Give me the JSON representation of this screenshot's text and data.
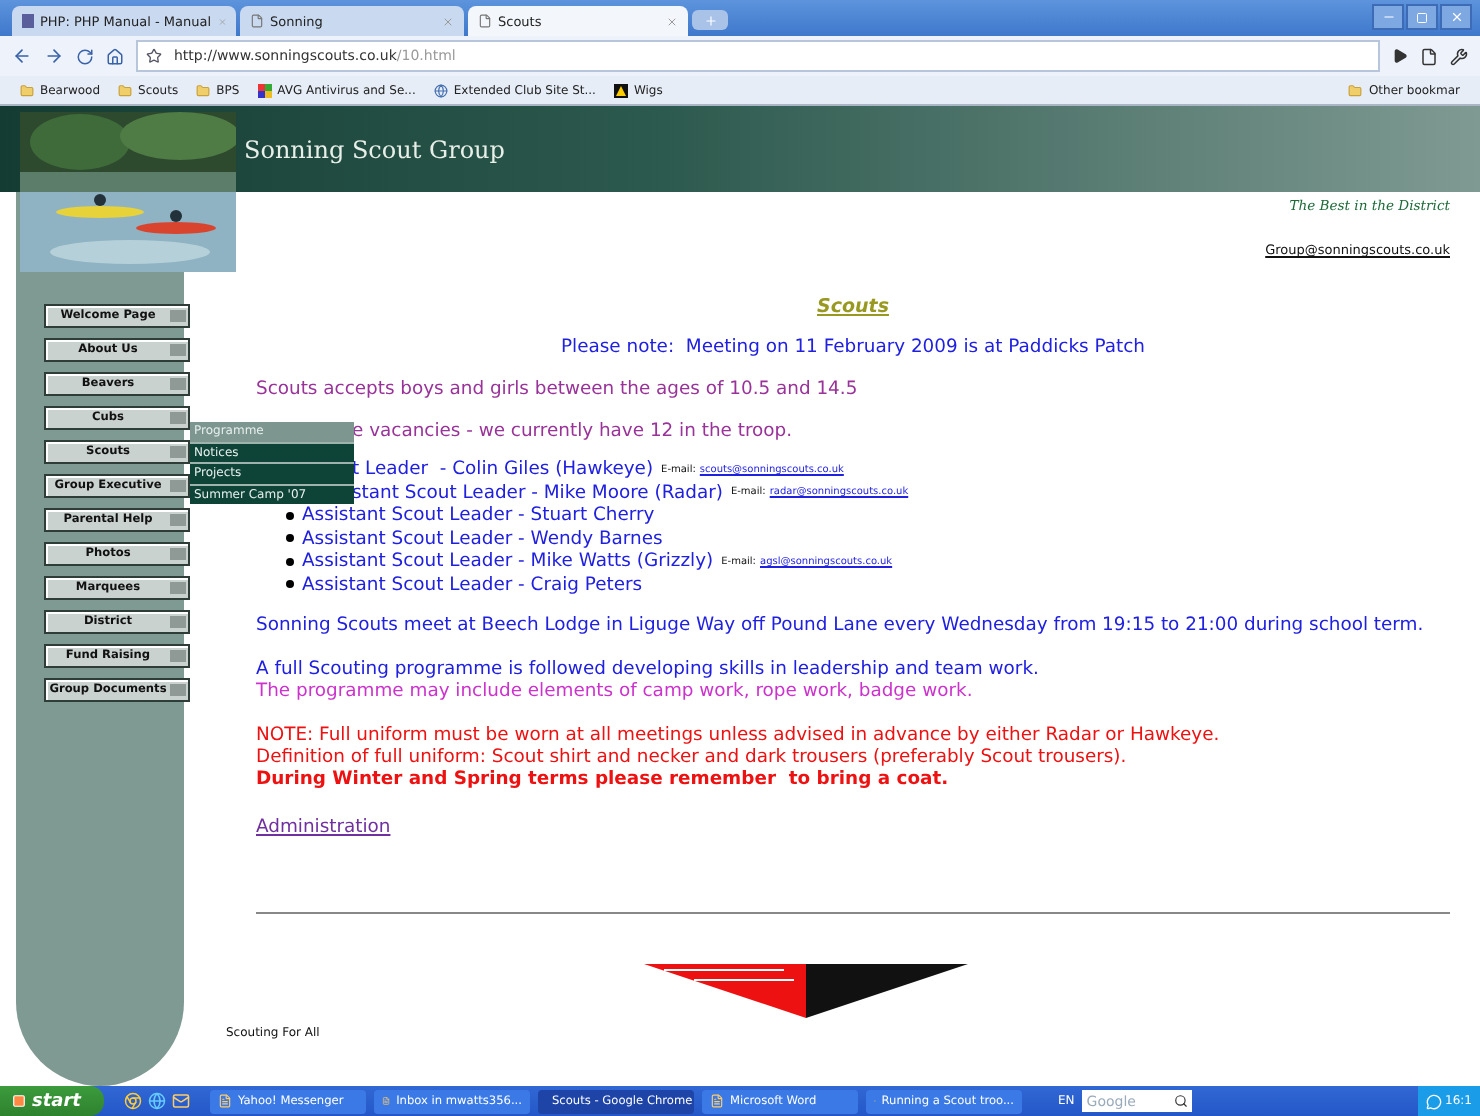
{
  "browser": {
    "tabs": [
      {
        "title": "PHP: PHP Manual - Manual",
        "kind": "php",
        "selected": false
      },
      {
        "title": "Sonning",
        "kind": "page",
        "selected": false
      },
      {
        "title": "Scouts",
        "kind": "page",
        "selected": true
      }
    ],
    "address_host": "http://www.sonningscouts.co.uk",
    "address_path": "/10.html",
    "bookmarks": [
      {
        "label": "Bearwood",
        "kind": "folder"
      },
      {
        "label": "Scouts",
        "kind": "folder"
      },
      {
        "label": "BPS",
        "kind": "folder"
      },
      {
        "label": "AVG Antivirus and Se...",
        "kind": "avg"
      },
      {
        "label": "Extended Club Site St...",
        "kind": "site"
      },
      {
        "label": "Wigs",
        "kind": "wigs"
      }
    ],
    "other_bookmarks": "Other bookmar"
  },
  "site": {
    "title": "Sonning Scout Group",
    "tagline": "The Best in the District",
    "email": "Group@sonningscouts.co.uk",
    "nav": [
      {
        "label": "Welcome Page"
      },
      {
        "label": "About Us"
      },
      {
        "label": "Beavers"
      },
      {
        "label": "Cubs"
      },
      {
        "label": "Scouts"
      },
      {
        "label": "Group Executive"
      },
      {
        "label": "Parental Help"
      },
      {
        "label": "Photos"
      },
      {
        "label": "Marquees"
      },
      {
        "label": "District"
      },
      {
        "label": "Fund Raising"
      },
      {
        "label": "Group Documents"
      }
    ],
    "submenu": [
      {
        "label": "Programme",
        "selected": true
      },
      {
        "label": "Notices",
        "selected": false
      },
      {
        "label": "Projects",
        "selected": false
      },
      {
        "label": "Summer Camp '07",
        "selected": false
      }
    ],
    "heading": "Scouts",
    "note": "Please note:  Meeting on 11 February 2009 is at Paddicks Patch",
    "intro": [
      {
        "text": "Scouts accepts boys and girls between the ages of 10.5 and 14.5",
        "color": "#993399"
      },
      {
        "text": "e vacancies - we currently have 12 in the troop.",
        "color": "#993399",
        "covered": true
      }
    ],
    "leaders": [
      {
        "text": "t Leader  - Colin Giles (Hawkeye)",
        "covered": true,
        "email_label": "E-mail:",
        "email": "scouts@sonningscouts.co.uk"
      },
      {
        "text": "stant Scout Leader - Mike Moore (Radar)",
        "covered": true,
        "email_label": "E-mail:",
        "email": "radar@sonningscouts.co.uk"
      },
      {
        "text": "Assistant Scout Leader - Stuart Cherry"
      },
      {
        "text": "Assistant Scout Leader - Wendy Barnes"
      },
      {
        "text": "Assistant Scout Leader - Mike Watts (Grizzly)",
        "email_label": "E-mail:",
        "email": "agsl@sonningscouts.co.uk"
      },
      {
        "text": "Assistant Scout Leader - Craig Peters"
      }
    ],
    "blocks": [
      {
        "lines": [
          {
            "text": "Sonning Scouts meet at Beech Lodge in Liguge Way off Pound Lane every Wednesday from 19:15 to 21:00 during school term.",
            "color": "#2020e0",
            "bold": false
          }
        ]
      },
      {
        "lines": [
          {
            "text": "A full Scouting programme is followed developing skills in leadership and team work.",
            "color": "#2020e0",
            "bold": false
          },
          {
            "text": "The programme may include elements of camp work, rope work, badge work.",
            "color": "#cc33cc",
            "bold": false
          }
        ]
      },
      {
        "lines": [
          {
            "text": "NOTE: Full uniform must be worn at all meetings unless advised in advance by either Radar or Hawkeye.",
            "color": "#ee1111",
            "bold": false
          },
          {
            "text": "Definition of full uniform: Scout shirt and necker and dark trousers (preferably Scout trousers).",
            "color": "#ee1111",
            "bold": false
          },
          {
            "text": "During Winter and Spring terms please remember  to bring a coat.",
            "color": "#ee1111",
            "bold": true
          }
        ]
      }
    ],
    "link": "Administration",
    "footer": "Scouting For All"
  },
  "taskbar": {
    "start": "start",
    "tasks": [
      {
        "label": "Yahoo! Messenger",
        "selected": false
      },
      {
        "label": "Inbox in mwatts356...",
        "selected": false
      },
      {
        "label": "Scouts - Google Chrome",
        "selected": true
      },
      {
        "label": "Microsoft Word",
        "selected": false
      },
      {
        "label": "Running a Scout troo...",
        "selected": false
      }
    ],
    "language": "EN",
    "search_logo": "Google",
    "clock": "16:1"
  }
}
